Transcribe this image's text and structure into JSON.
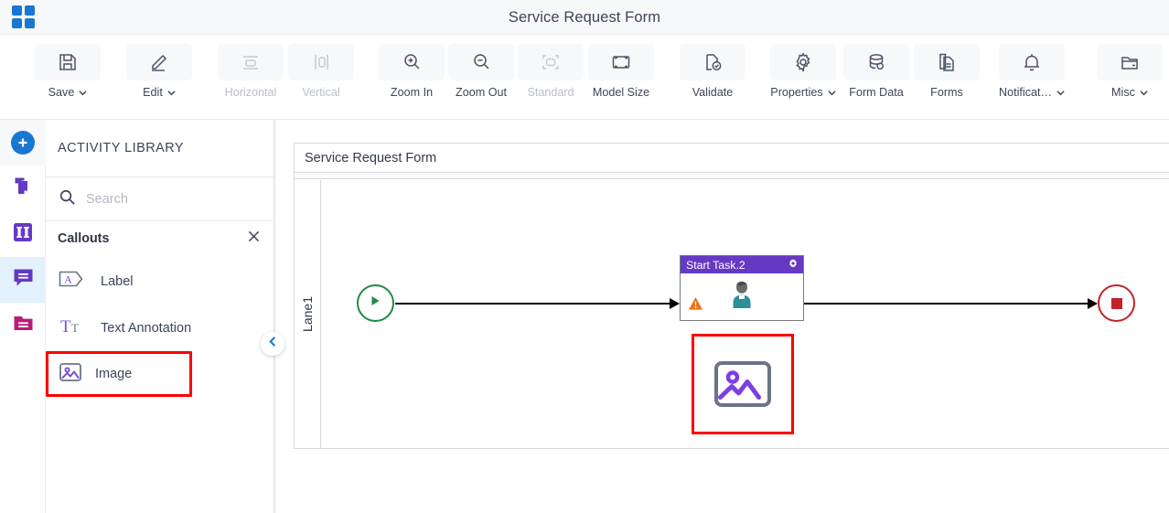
{
  "titlebar": {
    "app_launcher_icon": "app-grid-icon",
    "title": "Service Request Form"
  },
  "toolbar": {
    "items": [
      {
        "label": "Save",
        "icon": "save-icon",
        "caret": true,
        "disabled": false
      },
      {
        "label": "Edit",
        "icon": "pencil-icon",
        "caret": true,
        "disabled": false
      },
      {
        "label": "Horizontal",
        "icon": "horizontal-icon",
        "caret": false,
        "disabled": true
      },
      {
        "label": "Vertical",
        "icon": "vertical-icon",
        "caret": false,
        "disabled": true
      },
      {
        "label": "Zoom In",
        "icon": "zoom-in-icon",
        "caret": false,
        "disabled": false
      },
      {
        "label": "Zoom Out",
        "icon": "zoom-out-icon",
        "caret": false,
        "disabled": false
      },
      {
        "label": "Standard",
        "icon": "standard-icon",
        "caret": false,
        "disabled": true
      },
      {
        "label": "Model Size",
        "icon": "model-size-icon",
        "caret": false,
        "disabled": false
      },
      {
        "label": "Validate",
        "icon": "validate-icon",
        "caret": false,
        "disabled": false
      },
      {
        "label": "Properties",
        "icon": "gear-icon",
        "caret": true,
        "disabled": false
      },
      {
        "label": "Form Data",
        "icon": "database-icon",
        "caret": false,
        "disabled": false
      },
      {
        "label": "Forms",
        "icon": "document-icon",
        "caret": false,
        "disabled": false
      },
      {
        "label": "Notificat…",
        "icon": "bell-icon",
        "caret": true,
        "disabled": false
      },
      {
        "label": "Misc",
        "icon": "folder-icon",
        "caret": true,
        "disabled": false
      }
    ]
  },
  "rail": {
    "items": [
      {
        "name": "add-button",
        "icon": "plus-circle-icon",
        "active": false,
        "color": "#1877d2"
      },
      {
        "name": "templates",
        "icon": "copy-pages-icon",
        "active": false,
        "color": "#6639c4"
      },
      {
        "name": "swimlanes",
        "icon": "columns-icon",
        "active": false,
        "color": "#6639c4"
      },
      {
        "name": "callouts",
        "icon": "comment-icon",
        "active": true,
        "color": "#6639c4"
      },
      {
        "name": "folders",
        "icon": "folder-lines-icon",
        "active": false,
        "color": "#b91d7a"
      }
    ]
  },
  "library": {
    "title": "ACTIVITY LIBRARY",
    "search": {
      "value": "",
      "placeholder": "Search",
      "icon": "search-icon"
    },
    "group": {
      "name": "Callouts",
      "close_icon": "close-icon"
    },
    "items": [
      {
        "label": "Label",
        "icon": "label-tag-icon",
        "selected": false
      },
      {
        "label": "Text Annotation",
        "icon": "text-annotation-icon",
        "selected": false
      },
      {
        "label": "Image",
        "icon": "image-icon",
        "selected": true
      }
    ],
    "collapse_icon": "chevron-left-icon"
  },
  "canvas": {
    "pool_name": "Service Request Form",
    "lane_name": "Lane1",
    "shapes": {
      "start_event": {
        "name": "start-event",
        "icon": "play-icon",
        "color": "#1e8c43"
      },
      "task": {
        "title": "Start Task.2",
        "header_color": "#6639c4",
        "gear_icon": "gear-icon",
        "body_icon": "user-icon",
        "warning_icon": "warning-icon"
      },
      "image_shape": {
        "name": "image-shape",
        "icon": "image-icon",
        "highlight_color": "#fe0000"
      },
      "end_event": {
        "name": "end-event",
        "icon": "stop-square-icon",
        "color": "#c0232a"
      }
    }
  }
}
